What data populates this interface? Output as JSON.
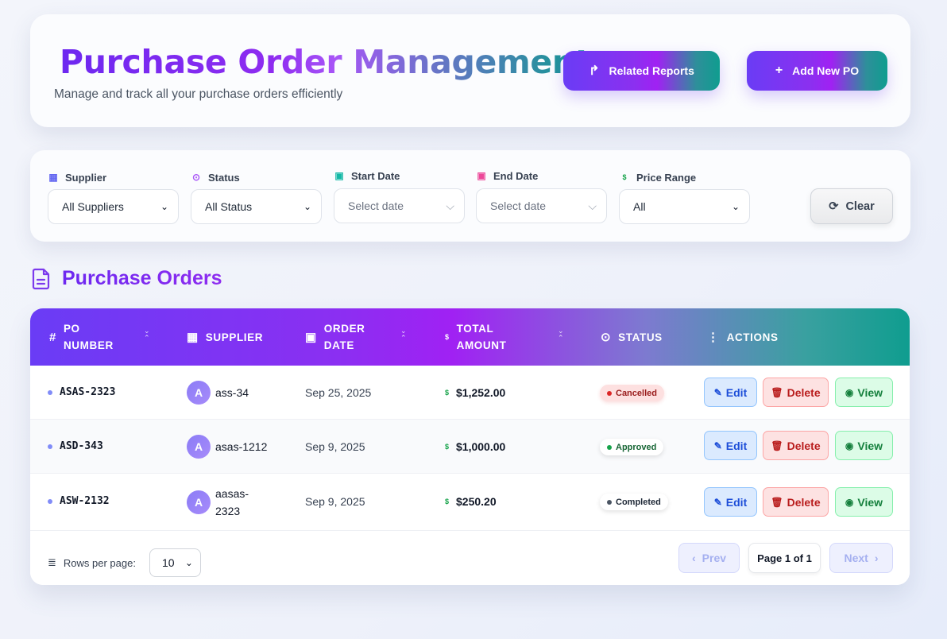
{
  "header": {
    "title": "Purchase Order Management",
    "subtitle": "Manage and track all your purchase orders efficiently",
    "reports_label": "Related Reports",
    "add_label": "Add New PO"
  },
  "filters": {
    "supplier": {
      "label": "Supplier",
      "value": "All Suppliers",
      "icon": "building-icon"
    },
    "status": {
      "label": "Status",
      "value": "All Status",
      "icon": "check-circle-icon"
    },
    "start_date": {
      "label": "Start Date",
      "placeholder": "Select date",
      "icon": "calendar-icon"
    },
    "end_date": {
      "label": "End Date",
      "placeholder": "Select date",
      "icon": "calendar-icon"
    },
    "price_range": {
      "label": "Price Range",
      "value": "All",
      "icon": "dollar-icon"
    },
    "clear_label": "Clear"
  },
  "section": {
    "title": "Purchase Orders"
  },
  "table": {
    "headers": {
      "po_number": [
        "PO",
        "NUMBER"
      ],
      "supplier": "SUPPLIER",
      "order_date": [
        "ORDER",
        "DATE"
      ],
      "total_amount": [
        "TOTAL",
        "AMOUNT"
      ],
      "status": "STATUS",
      "actions": "ACTIONS"
    },
    "rows": [
      {
        "po": "ASAS-2323",
        "avatar": "A",
        "supplier": "ass-34",
        "date": "Sep 25, 2025",
        "amount": "$1,252.00",
        "status": "Cancelled"
      },
      {
        "po": "ASD-343",
        "avatar": "A",
        "supplier": "asas-1212",
        "date": "Sep 9, 2025",
        "amount": "$1,000.00",
        "status": "Approved"
      },
      {
        "po": "ASW-2132",
        "avatar": "A",
        "supplier": "aasas-2323",
        "supplier_lines": [
          "aasas-",
          "2323"
        ],
        "date": "Sep 9, 2025",
        "amount": "$250.20",
        "status": "Completed"
      }
    ],
    "actions": {
      "edit": "Edit",
      "delete": "Delete",
      "view": "View"
    }
  },
  "pagination": {
    "rows_label": "Rows per page:",
    "rows_value": "10",
    "prev": "Prev",
    "info": "Page 1 of 1",
    "next": "Next"
  },
  "colors": {
    "accent_purple": "#6d28f0",
    "accent_teal": "#0f9d8f",
    "cancelled": "#dc2626",
    "approved": "#16a34a",
    "completed": "#4b5563"
  }
}
